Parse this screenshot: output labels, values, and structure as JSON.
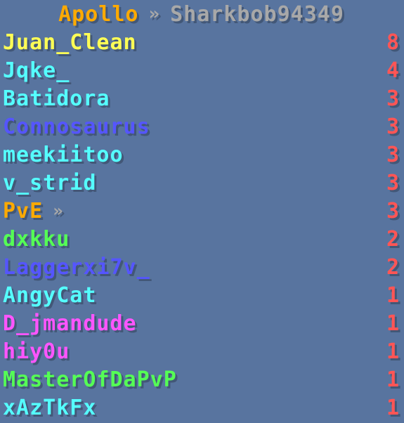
{
  "header": {
    "team": "Apollo",
    "separator": "»",
    "player": "Sharkbob94349",
    "team_color": "#ffaa00",
    "player_color": "#a8a8a8"
  },
  "arrow_glyph": "»",
  "rows": [
    {
      "name": "Juan_Clean",
      "score": "8",
      "color": "#ffff55",
      "arrow": false
    },
    {
      "name": "Jqke_",
      "score": "4",
      "color": "#55ffff",
      "arrow": false
    },
    {
      "name": "Batidora",
      "score": "3",
      "color": "#55ffff",
      "arrow": false
    },
    {
      "name": "Connosaurus",
      "score": "3",
      "color": "#5555ff",
      "arrow": false
    },
    {
      "name": "meekiitoo",
      "score": "3",
      "color": "#55ffff",
      "arrow": false
    },
    {
      "name": "v_strid",
      "score": "3",
      "color": "#55ffff",
      "arrow": false
    },
    {
      "name": "PvE",
      "score": "3",
      "color": "#ffaa00",
      "arrow": true
    },
    {
      "name": "dxkku",
      "score": "2",
      "color": "#55ff55",
      "arrow": false
    },
    {
      "name": "Laggerxi7v_",
      "score": "2",
      "color": "#5555ff",
      "arrow": false
    },
    {
      "name": "AngyCat",
      "score": "1",
      "color": "#55ffff",
      "arrow": false
    },
    {
      "name": "D_jmandude",
      "score": "1",
      "color": "#ff55ff",
      "arrow": false
    },
    {
      "name": "hiy0u",
      "score": "1",
      "color": "#ff55ff",
      "arrow": false
    },
    {
      "name": "MasterOfDaPvP",
      "score": "1",
      "color": "#55ff55",
      "arrow": false
    },
    {
      "name": "xAzTkFx",
      "score": "1",
      "color": "#55ffff",
      "arrow": false
    }
  ]
}
